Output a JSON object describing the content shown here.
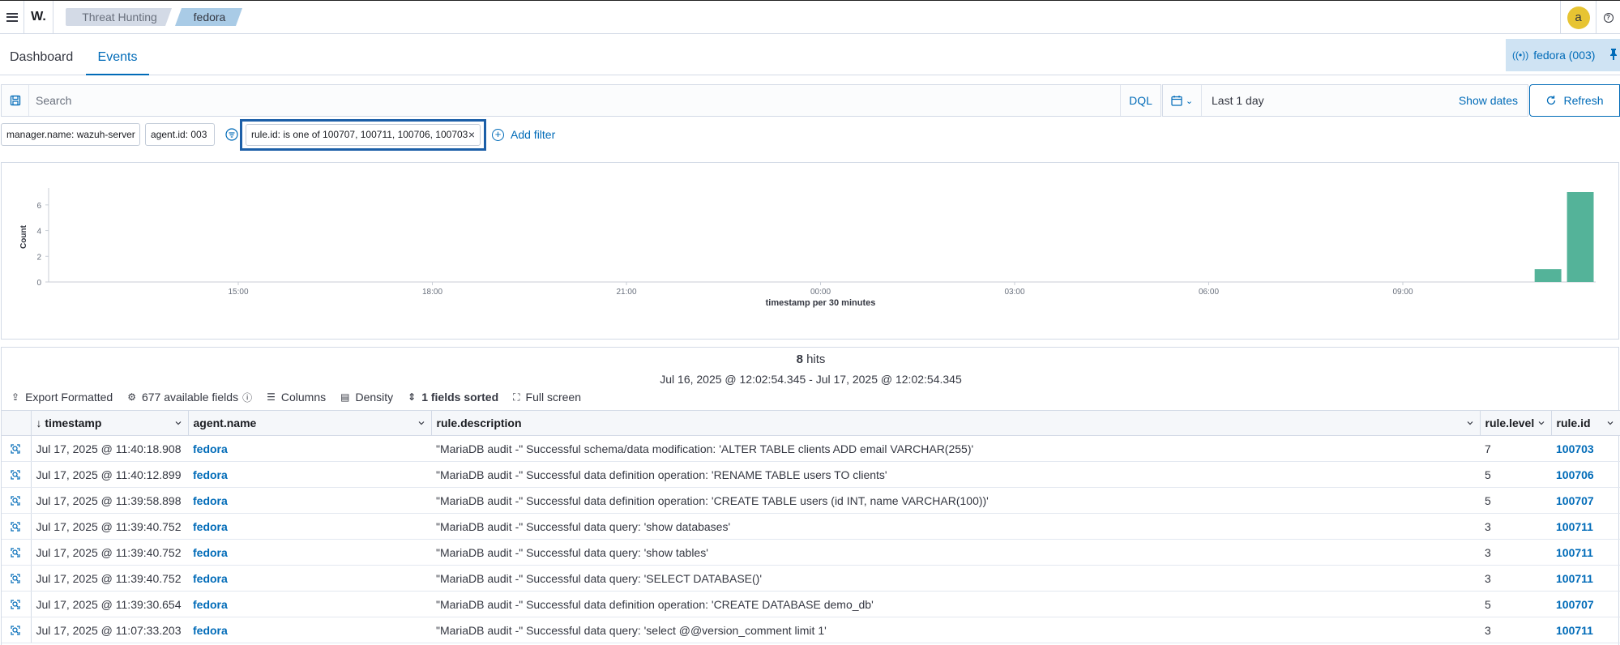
{
  "header": {
    "logo": "W.",
    "breadcrumbs": [
      "Threat Hunting",
      "fedora"
    ],
    "avatar_letter": "a",
    "help_glyph": "?"
  },
  "tabs": [
    {
      "label": "Dashboard",
      "active": false
    },
    {
      "label": "Events",
      "active": true
    }
  ],
  "agent_pill": {
    "label": "fedora (003)",
    "icon": "radio-icon"
  },
  "query": {
    "placeholder": "Search",
    "language": "DQL",
    "time_range": "Last 1 day",
    "show_dates": "Show dates",
    "refresh": "Refresh"
  },
  "filters": [
    "manager.name: wazuh-server",
    "agent.id: 003",
    "rule.id: is one of 100707, 100711, 100706, 100703"
  ],
  "add_filter": "Add filter",
  "chart_data": {
    "type": "bar",
    "ylabel": "Count",
    "xlabel": "timestamp per 30 minutes",
    "ylim": [
      0,
      7
    ],
    "yticks": [
      0,
      2,
      4,
      6
    ],
    "x_ticks": [
      "15:00",
      "18:00",
      "21:00",
      "00:00",
      "03:00",
      "06:00",
      "09:00"
    ],
    "bars": [
      {
        "bucket": "Jul 17, 2025 @ 11:00",
        "value": 1
      },
      {
        "bucket": "Jul 17, 2025 @ 11:30",
        "value": 7
      }
    ],
    "color": "#54b399"
  },
  "results": {
    "hits_count": "8",
    "hits_label": "hits",
    "date_range": "Jul 16, 2025 @ 12:02:54.345 - Jul 17, 2025 @ 12:02:54.345",
    "toolbar": {
      "export": "Export Formatted",
      "fields": "677 available fields",
      "columns": "Columns",
      "density": "Density",
      "sorted": "1 fields sorted",
      "fullscreen": "Full screen"
    },
    "columns": [
      "timestamp",
      "agent.name",
      "rule.description",
      "rule.level",
      "rule.id"
    ],
    "rows": [
      {
        "timestamp": "Jul 17, 2025 @ 11:40:18.908",
        "agent": "fedora",
        "description": "\"MariaDB audit -\" Successful schema/data modification: 'ALTER TABLE clients ADD email VARCHAR(255)'",
        "level": "7",
        "rule_id": "100703"
      },
      {
        "timestamp": "Jul 17, 2025 @ 11:40:12.899",
        "agent": "fedora",
        "description": "\"MariaDB audit -\" Successful data definition operation: 'RENAME TABLE users TO clients'",
        "level": "5",
        "rule_id": "100706"
      },
      {
        "timestamp": "Jul 17, 2025 @ 11:39:58.898",
        "agent": "fedora",
        "description": "\"MariaDB audit -\" Successful data definition operation: 'CREATE TABLE users (id INT, name VARCHAR(100))'",
        "level": "5",
        "rule_id": "100707"
      },
      {
        "timestamp": "Jul 17, 2025 @ 11:39:40.752",
        "agent": "fedora",
        "description": "\"MariaDB audit -\" Successful data query: 'show databases'",
        "level": "3",
        "rule_id": "100711"
      },
      {
        "timestamp": "Jul 17, 2025 @ 11:39:40.752",
        "agent": "fedora",
        "description": "\"MariaDB audit -\" Successful data query: 'show tables'",
        "level": "3",
        "rule_id": "100711"
      },
      {
        "timestamp": "Jul 17, 2025 @ 11:39:40.752",
        "agent": "fedora",
        "description": "\"MariaDB audit -\" Successful data query: 'SELECT DATABASE()'",
        "level": "3",
        "rule_id": "100711"
      },
      {
        "timestamp": "Jul 17, 2025 @ 11:39:30.654",
        "agent": "fedora",
        "description": "\"MariaDB audit -\" Successful data definition operation: 'CREATE DATABASE demo_db'",
        "level": "5",
        "rule_id": "100707"
      },
      {
        "timestamp": "Jul 17, 2025 @ 11:07:33.203",
        "agent": "fedora",
        "description": "\"MariaDB audit -\" Successful data query: 'select @@version_comment limit 1'",
        "level": "3",
        "rule_id": "100711"
      }
    ]
  },
  "colors": {
    "accent": "#006bb8",
    "bar": "#54b399",
    "highlight_border": "#1c5fa8"
  }
}
